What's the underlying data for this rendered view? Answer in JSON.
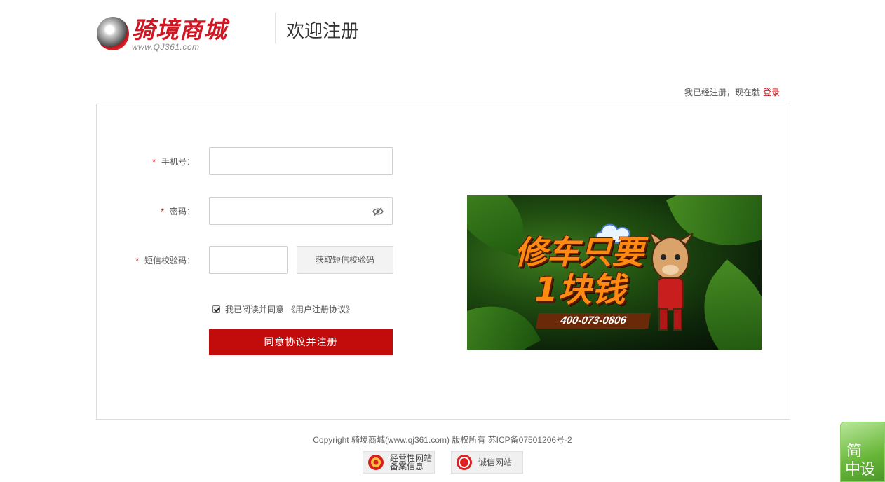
{
  "header": {
    "logo_text": "骑境商城",
    "logo_sub": "www.QJ361.com",
    "page_title": "欢迎注册"
  },
  "login_hint": {
    "text": "我已经注册，现在就",
    "link": "登录"
  },
  "form": {
    "required_mark": "*",
    "phone_label": "手机号：",
    "password_label": "密码：",
    "sms_label": "短信校验码：",
    "phone_value": "",
    "password_value": "",
    "sms_value": "",
    "sms_button": "获取短信校验码",
    "agree_checked": true,
    "agree_text": "我已阅读并同意",
    "agree_link": "《用户注册协议》",
    "submit_label": "同意协议并注册"
  },
  "banner": {
    "line1": "修车只要",
    "line2": "1块钱",
    "phone": "400-073-0806"
  },
  "footer": {
    "copyright": "Copyright 骑境商城(www.qj361.com) 版权所有 苏ICP备07501206号-2",
    "badge1_line1": "经营性网站",
    "badge1_line2": "备案信息",
    "badge2": "诚信网站"
  },
  "side_widget": {
    "line1": "简",
    "line2": "中设"
  },
  "colors": {
    "accent": "#c20b0b",
    "brand_red": "#d01723"
  }
}
